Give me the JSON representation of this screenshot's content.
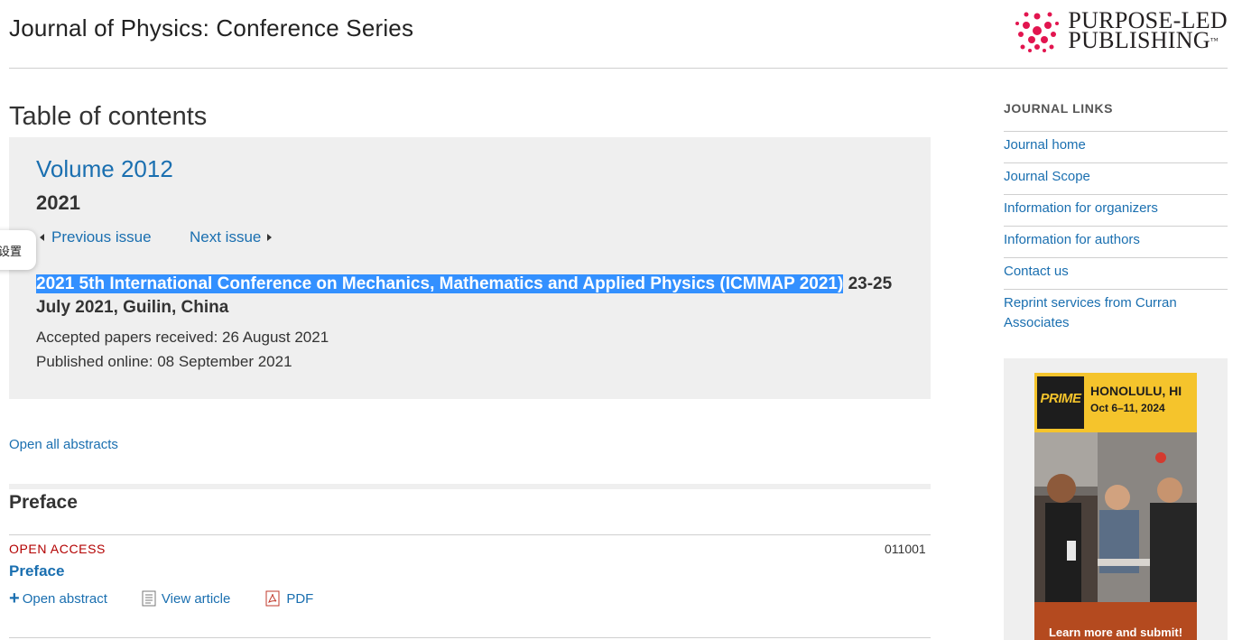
{
  "header": {
    "journal_title": "Journal of Physics: Conference Series",
    "publisher_line1": "PURPOSE-LED",
    "publisher_line2": "PUBLISHING",
    "publisher_tm": "™",
    "publisher_logo_icon": "dots-logo-icon",
    "brand_color": "#e2154f"
  },
  "toc": {
    "heading": "Table of contents"
  },
  "issue": {
    "volume": "Volume 2012",
    "year": "2021",
    "prev_label": "Previous issue",
    "next_label": "Next issue",
    "conference_highlighted": "2021 5th International Conference on Mechanics, Mathematics and Applied Physics (ICMMAP 2021)",
    "conference_rest": " 23-25 July 2021, Guilin, China",
    "accepted": "Accepted papers received: 26 August 2021",
    "published": "Published online: 08 September 2021",
    "highlight_color": "#3390ff"
  },
  "float_widget": {
    "label": "设置"
  },
  "actions": {
    "open_all": "Open all abstracts"
  },
  "section": {
    "title": "Preface",
    "articles": [
      {
        "access": "OPEN ACCESS",
        "number": "011001",
        "title": "Preface",
        "open_abstract": "Open abstract",
        "view_article": "View article",
        "pdf": "PDF"
      }
    ]
  },
  "sidebar": {
    "heading": "JOURNAL LINKS",
    "links": [
      "Journal home",
      "Journal Scope",
      "Information for organizers",
      "Information for authors",
      "Contact us",
      "Reprint services from Curran Associates"
    ]
  },
  "ad": {
    "logo_text": "PRIME",
    "city": "HONOLULU, HI",
    "dates": "Oct 6–11, 2024",
    "cta": "Learn more and submit!"
  },
  "colors": {
    "link": "#1a6fb0",
    "open_access": "#b30000",
    "panel": "#efefef"
  }
}
